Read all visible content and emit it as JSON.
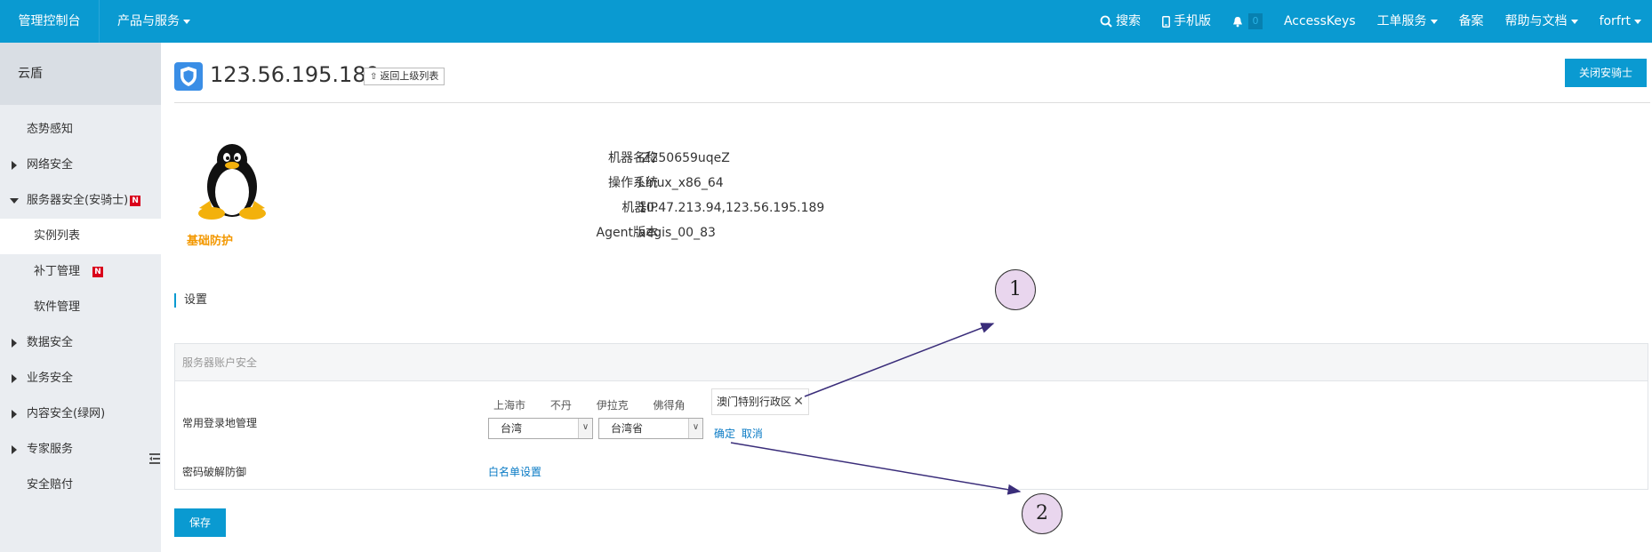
{
  "topbar": {
    "brand": "管理控制台",
    "products": "产品与服务",
    "search": "搜索",
    "mobile": "手机版",
    "notifications_count": "0",
    "access_keys": "AccessKeys",
    "tickets": "工单服务",
    "filing": "备案",
    "help": "帮助与文档",
    "user": "forfrt"
  },
  "sidebar": {
    "title": "云盾",
    "items": [
      {
        "label": "态势感知"
      },
      {
        "label": "网络安全"
      },
      {
        "label": "服务器安全(安骑士)",
        "badge": "N"
      },
      {
        "label": "实例列表"
      },
      {
        "label": "补丁管理",
        "badge": "N"
      },
      {
        "label": "软件管理"
      },
      {
        "label": "数据安全"
      },
      {
        "label": "业务安全"
      },
      {
        "label": "内容安全(绿网)"
      },
      {
        "label": "专家服务"
      },
      {
        "label": "安全赔付"
      }
    ]
  },
  "header": {
    "ip": "123.56.195.189",
    "back_label": "返回上级列表",
    "close_label": "关闭安骑士"
  },
  "machine": {
    "tier": "基础防护",
    "labels": [
      "机器名称",
      "操作系统",
      "机器IP",
      "Agent版本"
    ],
    "values": [
      "iZ250659uqeZ",
      "Linux_x86_64",
      "10.47.213.94,123.56.195.189",
      "aegis_00_83"
    ]
  },
  "settings": {
    "title": "设置",
    "panel_title": "服务器账户安全",
    "login_location_label": "常用登录地管理",
    "locations": [
      "上海市",
      "不丹",
      "伊拉克",
      "佛得角"
    ],
    "selected_location": "澳门特别行政区",
    "country_select": "台湾",
    "province_select": "台湾省",
    "confirm": "确定",
    "cancel": "取消",
    "password_label": "密码破解防御",
    "whitelist_link": "白名单设置",
    "save": "保存"
  },
  "annotations": {
    "one": "1",
    "two": "2"
  },
  "colors": {
    "accent": "#0a9ad1",
    "warning": "#f39800",
    "badge": "#d9001b",
    "link": "#0a7bc5"
  }
}
